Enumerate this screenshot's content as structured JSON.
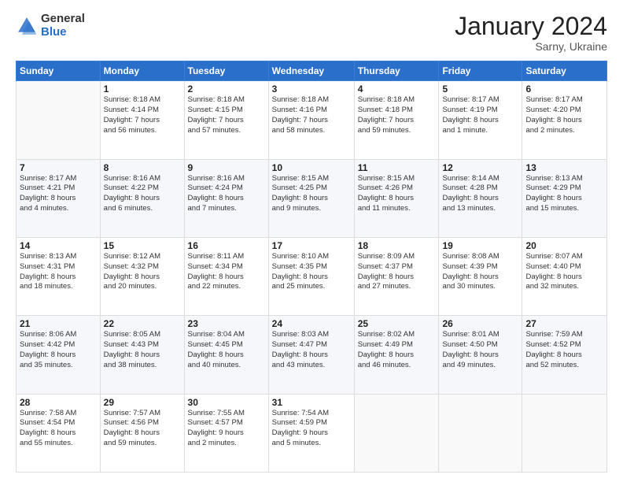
{
  "logo": {
    "general": "General",
    "blue": "Blue"
  },
  "header": {
    "title": "January 2024",
    "subtitle": "Sarny, Ukraine"
  },
  "columns": [
    "Sunday",
    "Monday",
    "Tuesday",
    "Wednesday",
    "Thursday",
    "Friday",
    "Saturday"
  ],
  "weeks": [
    [
      {
        "day": "",
        "info": ""
      },
      {
        "day": "1",
        "info": "Sunrise: 8:18 AM\nSunset: 4:14 PM\nDaylight: 7 hours\nand 56 minutes."
      },
      {
        "day": "2",
        "info": "Sunrise: 8:18 AM\nSunset: 4:15 PM\nDaylight: 7 hours\nand 57 minutes."
      },
      {
        "day": "3",
        "info": "Sunrise: 8:18 AM\nSunset: 4:16 PM\nDaylight: 7 hours\nand 58 minutes."
      },
      {
        "day": "4",
        "info": "Sunrise: 8:18 AM\nSunset: 4:18 PM\nDaylight: 7 hours\nand 59 minutes."
      },
      {
        "day": "5",
        "info": "Sunrise: 8:17 AM\nSunset: 4:19 PM\nDaylight: 8 hours\nand 1 minute."
      },
      {
        "day": "6",
        "info": "Sunrise: 8:17 AM\nSunset: 4:20 PM\nDaylight: 8 hours\nand 2 minutes."
      }
    ],
    [
      {
        "day": "7",
        "info": "Sunrise: 8:17 AM\nSunset: 4:21 PM\nDaylight: 8 hours\nand 4 minutes."
      },
      {
        "day": "8",
        "info": "Sunrise: 8:16 AM\nSunset: 4:22 PM\nDaylight: 8 hours\nand 6 minutes."
      },
      {
        "day": "9",
        "info": "Sunrise: 8:16 AM\nSunset: 4:24 PM\nDaylight: 8 hours\nand 7 minutes."
      },
      {
        "day": "10",
        "info": "Sunrise: 8:15 AM\nSunset: 4:25 PM\nDaylight: 8 hours\nand 9 minutes."
      },
      {
        "day": "11",
        "info": "Sunrise: 8:15 AM\nSunset: 4:26 PM\nDaylight: 8 hours\nand 11 minutes."
      },
      {
        "day": "12",
        "info": "Sunrise: 8:14 AM\nSunset: 4:28 PM\nDaylight: 8 hours\nand 13 minutes."
      },
      {
        "day": "13",
        "info": "Sunrise: 8:13 AM\nSunset: 4:29 PM\nDaylight: 8 hours\nand 15 minutes."
      }
    ],
    [
      {
        "day": "14",
        "info": "Sunrise: 8:13 AM\nSunset: 4:31 PM\nDaylight: 8 hours\nand 18 minutes."
      },
      {
        "day": "15",
        "info": "Sunrise: 8:12 AM\nSunset: 4:32 PM\nDaylight: 8 hours\nand 20 minutes."
      },
      {
        "day": "16",
        "info": "Sunrise: 8:11 AM\nSunset: 4:34 PM\nDaylight: 8 hours\nand 22 minutes."
      },
      {
        "day": "17",
        "info": "Sunrise: 8:10 AM\nSunset: 4:35 PM\nDaylight: 8 hours\nand 25 minutes."
      },
      {
        "day": "18",
        "info": "Sunrise: 8:09 AM\nSunset: 4:37 PM\nDaylight: 8 hours\nand 27 minutes."
      },
      {
        "day": "19",
        "info": "Sunrise: 8:08 AM\nSunset: 4:39 PM\nDaylight: 8 hours\nand 30 minutes."
      },
      {
        "day": "20",
        "info": "Sunrise: 8:07 AM\nSunset: 4:40 PM\nDaylight: 8 hours\nand 32 minutes."
      }
    ],
    [
      {
        "day": "21",
        "info": "Sunrise: 8:06 AM\nSunset: 4:42 PM\nDaylight: 8 hours\nand 35 minutes."
      },
      {
        "day": "22",
        "info": "Sunrise: 8:05 AM\nSunset: 4:43 PM\nDaylight: 8 hours\nand 38 minutes."
      },
      {
        "day": "23",
        "info": "Sunrise: 8:04 AM\nSunset: 4:45 PM\nDaylight: 8 hours\nand 40 minutes."
      },
      {
        "day": "24",
        "info": "Sunrise: 8:03 AM\nSunset: 4:47 PM\nDaylight: 8 hours\nand 43 minutes."
      },
      {
        "day": "25",
        "info": "Sunrise: 8:02 AM\nSunset: 4:49 PM\nDaylight: 8 hours\nand 46 minutes."
      },
      {
        "day": "26",
        "info": "Sunrise: 8:01 AM\nSunset: 4:50 PM\nDaylight: 8 hours\nand 49 minutes."
      },
      {
        "day": "27",
        "info": "Sunrise: 7:59 AM\nSunset: 4:52 PM\nDaylight: 8 hours\nand 52 minutes."
      }
    ],
    [
      {
        "day": "28",
        "info": "Sunrise: 7:58 AM\nSunset: 4:54 PM\nDaylight: 8 hours\nand 55 minutes."
      },
      {
        "day": "29",
        "info": "Sunrise: 7:57 AM\nSunset: 4:56 PM\nDaylight: 8 hours\nand 59 minutes."
      },
      {
        "day": "30",
        "info": "Sunrise: 7:55 AM\nSunset: 4:57 PM\nDaylight: 9 hours\nand 2 minutes."
      },
      {
        "day": "31",
        "info": "Sunrise: 7:54 AM\nSunset: 4:59 PM\nDaylight: 9 hours\nand 5 minutes."
      },
      {
        "day": "",
        "info": ""
      },
      {
        "day": "",
        "info": ""
      },
      {
        "day": "",
        "info": ""
      }
    ]
  ]
}
